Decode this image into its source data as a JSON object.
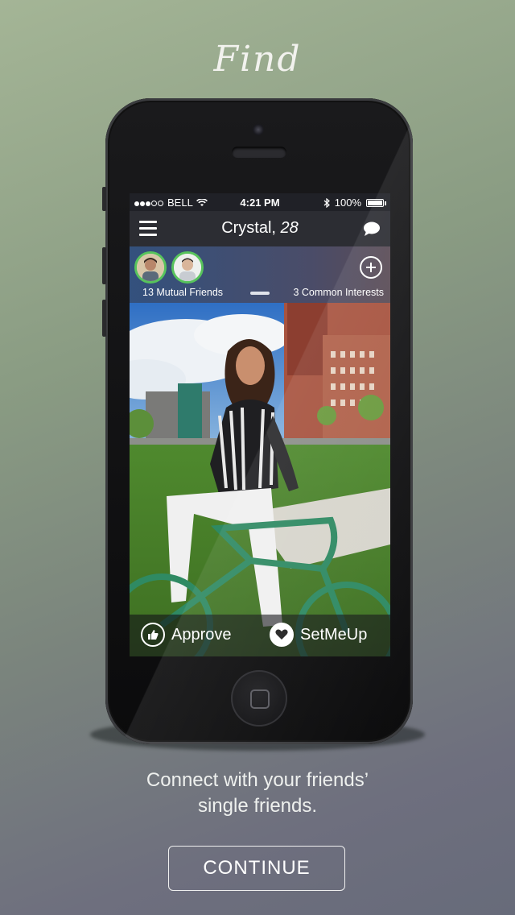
{
  "header": {
    "title": "Find"
  },
  "phone": {
    "status_bar": {
      "carrier": "BELL",
      "time": "4:21 PM",
      "battery_percent": "100%",
      "signal_bars_filled": 3,
      "signal_bars_total": 5
    },
    "nav": {
      "name": "Crystal,",
      "age": "28",
      "menu_icon": "hamburger-icon",
      "chat_icon": "chat-bubble-icon"
    },
    "friends_bar": {
      "mutual_friends": "13 Mutual Friends",
      "common_interests": "3 Common Interests",
      "add_icon": "plus-circle-icon",
      "avatars": [
        "friend-avatar-1",
        "friend-avatar-2"
      ]
    },
    "actions": {
      "approve_label": "Approve",
      "approve_icon": "thumbs-up-icon",
      "setmeup_label": "SetMeUp",
      "setmeup_icon": "heart-icon"
    }
  },
  "tagline": {
    "line1": "Connect with your friends’",
    "line2": "single friends."
  },
  "continue_button": {
    "label": "CONTINUE"
  },
  "colors": {
    "accent_green": "#57c35c",
    "navbar": "#2c2d33"
  }
}
